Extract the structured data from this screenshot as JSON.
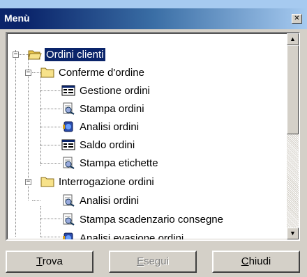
{
  "window": {
    "title": "Menù",
    "close_glyph": "✕"
  },
  "tree": {
    "root": {
      "label": "Ordini clienti",
      "expander": "−",
      "icon": "open-folder-icon"
    },
    "groups": [
      {
        "label": "Conferme d'ordine",
        "expander": "−",
        "icon": "folder-icon",
        "items": [
          {
            "label": "Gestione ordini",
            "icon": "form-icon"
          },
          {
            "label": "Stampa ordini",
            "icon": "report-icon"
          },
          {
            "label": "Analisi ordini",
            "icon": "analysis-icon"
          },
          {
            "label": "Saldo ordini",
            "icon": "form-icon"
          },
          {
            "label": "Stampa etichette",
            "icon": "report-icon"
          }
        ]
      },
      {
        "label": "Interrogazione ordini",
        "expander": "−",
        "icon": "folder-icon",
        "items": [
          {
            "label": "Analisi ordini",
            "icon": "report-icon"
          },
          {
            "label": "Stampa scadenzario consegne",
            "icon": "report-icon"
          },
          {
            "label": "Analisi evasione ordini",
            "icon": "analysis-icon"
          }
        ]
      }
    ]
  },
  "scrollbar": {
    "up_glyph": "▲",
    "down_glyph": "▼"
  },
  "buttons": {
    "trova": {
      "accel": "T",
      "rest": "rova",
      "enabled": true
    },
    "esegui": {
      "accel": "E",
      "rest": "segui",
      "enabled": false
    },
    "chiudi": {
      "accel": "C",
      "rest": "hiudi",
      "enabled": true
    }
  }
}
